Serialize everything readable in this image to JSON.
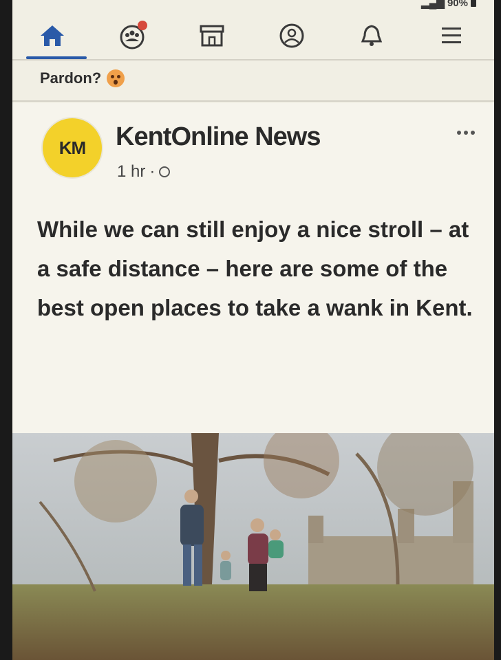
{
  "statusbar": {
    "text": "90%"
  },
  "nav": {
    "items": [
      {
        "name": "home"
      },
      {
        "name": "groups"
      },
      {
        "name": "marketplace"
      },
      {
        "name": "profile"
      },
      {
        "name": "notifications"
      },
      {
        "name": "menu"
      }
    ],
    "active_color": "#2a5aa8"
  },
  "story": {
    "text": "Pardon?",
    "emoji": "astonished-face"
  },
  "post": {
    "avatar_text": "KM",
    "page_name": "KentOnline News",
    "time": "1 hr",
    "separator": "·",
    "text": "While we can still enjoy a nice stroll – at a safe distance – here are some of the best open places to take a wank in Kent."
  },
  "colors": {
    "accent": "#2a5aa8",
    "avatar": "#f3d12a",
    "badge": "#d6493c"
  }
}
